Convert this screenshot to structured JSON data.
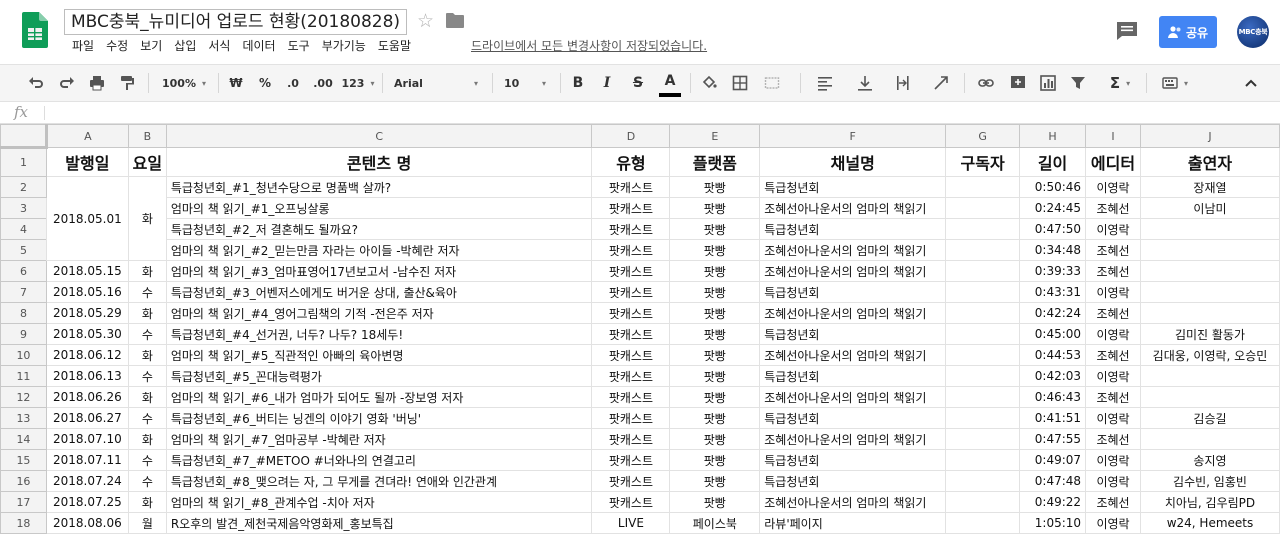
{
  "doc": {
    "title": "MBC충북_뉴미디어 업로드 현황(20180828)",
    "saved_notice": "드라이브에서 모든 변경사항이 저장되었습니다.",
    "share_label": "공유",
    "avatar_text": "MBC충북"
  },
  "menu": [
    "파일",
    "수정",
    "보기",
    "삽입",
    "서식",
    "데이터",
    "도구",
    "부가기능",
    "도움말"
  ],
  "toolbar": {
    "zoom": "100%",
    "currency": "₩",
    "percent": "%",
    "decimal_less": ".0",
    "decimal_more": ".00",
    "number_format": "123",
    "font": "Arial",
    "font_size": "10",
    "bold": "B",
    "italic": "I",
    "strike": "S",
    "text_color": "A",
    "sigma": "Σ"
  },
  "formula_bar": {
    "fx": "fx",
    "value": ""
  },
  "columns": [
    "A",
    "B",
    "C",
    "D",
    "E",
    "F",
    "G",
    "H",
    "I",
    "J"
  ],
  "header_row": [
    "발행일",
    "요일",
    "콘텐츠 명",
    "유형",
    "플랫폼",
    "채널명",
    "구독자",
    "길이",
    "에디터",
    "출연자"
  ],
  "merged_first": {
    "date": "2018.05.01",
    "day": "화"
  },
  "rows": [
    {
      "n": "2",
      "date": "",
      "day": "",
      "title": "특급청년회_#1_청년수당으로 명품백 살까?",
      "type": "팟캐스트",
      "platform": "팟빵",
      "channel": "특급청년회",
      "subs": "",
      "length": "0:50:46",
      "editor": "이영락",
      "cast": "장재열"
    },
    {
      "n": "3",
      "date": "",
      "day": "",
      "title": "엄마의 책 읽기_#1_오프닝살롱",
      "type": "팟캐스트",
      "platform": "팟빵",
      "channel": "조혜선아나운서의 엄마의 책읽기",
      "subs": "",
      "length": "0:24:45",
      "editor": "조혜선",
      "cast": "이남미"
    },
    {
      "n": "4",
      "date": "",
      "day": "",
      "title": "특급청년회_#2_저 결혼해도 될까요?",
      "type": "팟캐스트",
      "platform": "팟빵",
      "channel": "특급청년회",
      "subs": "",
      "length": "0:47:50",
      "editor": "이영락",
      "cast": ""
    },
    {
      "n": "5",
      "date": "",
      "day": "",
      "title": "엄마의 책 읽기_#2_믿는만큼 자라는 아이들 -박혜란 저자",
      "type": "팟캐스트",
      "platform": "팟빵",
      "channel": "조혜선아나운서의 엄마의 책읽기",
      "subs": "",
      "length": "0:34:48",
      "editor": "조혜선",
      "cast": ""
    },
    {
      "n": "6",
      "date": "2018.05.15",
      "day": "화",
      "title": "엄마의 책 읽기_#3_엄마표영어17년보고서 -남수진 저자",
      "type": "팟캐스트",
      "platform": "팟빵",
      "channel": "조혜선아나운서의 엄마의 책읽기",
      "subs": "",
      "length": "0:39:33",
      "editor": "조혜선",
      "cast": ""
    },
    {
      "n": "7",
      "date": "2018.05.16",
      "day": "수",
      "title": "특급청년회_#3_어벤저스에게도 버거운 상대, 출산&육아",
      "type": "팟캐스트",
      "platform": "팟빵",
      "channel": "특급청년회",
      "subs": "",
      "length": "0:43:31",
      "editor": "이영락",
      "cast": ""
    },
    {
      "n": "8",
      "date": "2018.05.29",
      "day": "화",
      "title": "엄마의 책 읽기_#4_영어그림책의 기적 -전은주 저자",
      "type": "팟캐스트",
      "platform": "팟빵",
      "channel": "조혜선아나운서의 엄마의 책읽기",
      "subs": "",
      "length": "0:42:24",
      "editor": "조혜선",
      "cast": ""
    },
    {
      "n": "9",
      "date": "2018.05.30",
      "day": "수",
      "title": "특급청년회_#4_선거권, 너두? 나두? 18세두!",
      "type": "팟캐스트",
      "platform": "팟빵",
      "channel": "특급청년회",
      "subs": "",
      "length": "0:45:00",
      "editor": "이영락",
      "cast": "김미진 활동가"
    },
    {
      "n": "10",
      "date": "2018.06.12",
      "day": "화",
      "title": "엄마의 책 읽기_#5_직관적인 아빠의 육아변명",
      "type": "팟캐스트",
      "platform": "팟빵",
      "channel": "조혜선아나운서의 엄마의 책읽기",
      "subs": "",
      "length": "0:44:53",
      "editor": "조혜선",
      "cast": "김대웅, 이영락, 오승민"
    },
    {
      "n": "11",
      "date": "2018.06.13",
      "day": "수",
      "title": "특급청년회_#5_꼰대능력평가",
      "type": "팟캐스트",
      "platform": "팟빵",
      "channel": "특급청년회",
      "subs": "",
      "length": "0:42:03",
      "editor": "이영락",
      "cast": ""
    },
    {
      "n": "12",
      "date": "2018.06.26",
      "day": "화",
      "title": "엄마의 책 읽기_#6_내가 엄마가 되어도 될까 -장보영 저자",
      "type": "팟캐스트",
      "platform": "팟빵",
      "channel": "조혜선아나운서의 엄마의 책읽기",
      "subs": "",
      "length": "0:46:43",
      "editor": "조혜선",
      "cast": ""
    },
    {
      "n": "13",
      "date": "2018.06.27",
      "day": "수",
      "title": "특급청년회_#6_버티는 닝겐의 이야기 영화 '버닝'",
      "type": "팟캐스트",
      "platform": "팟빵",
      "channel": "특급청년회",
      "subs": "",
      "length": "0:41:51",
      "editor": "이영락",
      "cast": "김승길"
    },
    {
      "n": "14",
      "date": "2018.07.10",
      "day": "화",
      "title": "엄마의 책 읽기_#7_엄마공부 -박혜란 저자",
      "type": "팟캐스트",
      "platform": "팟빵",
      "channel": "조혜선아나운서의 엄마의 책읽기",
      "subs": "",
      "length": "0:47:55",
      "editor": "조혜선",
      "cast": ""
    },
    {
      "n": "15",
      "date": "2018.07.11",
      "day": "수",
      "title": "특급청년회_#7_#METOO #너와나의 연결고리",
      "type": "팟캐스트",
      "platform": "팟빵",
      "channel": "특급청년회",
      "subs": "",
      "length": "0:49:07",
      "editor": "이영락",
      "cast": "송지영"
    },
    {
      "n": "16",
      "date": "2018.07.24",
      "day": "수",
      "title": "특급청년회_#8_맺으려는 자, 그 무게를 견뎌라! 연애와 인간관계",
      "type": "팟캐스트",
      "platform": "팟빵",
      "channel": "특급청년회",
      "subs": "",
      "length": "0:47:48",
      "editor": "이영락",
      "cast": "김수빈, 임홍빈"
    },
    {
      "n": "17",
      "date": "2018.07.25",
      "day": "화",
      "title": "엄마의 책 읽기_#8_관계수업 -치아 저자",
      "type": "팟캐스트",
      "platform": "팟빵",
      "channel": "조혜선아나운서의 엄마의 책읽기",
      "subs": "",
      "length": "0:49:22",
      "editor": "조혜선",
      "cast": "치아님, 김우림PD"
    },
    {
      "n": "18",
      "date": "2018.08.06",
      "day": "월",
      "title": "R오후의 발견_제천국제음악영화제_홍보특집",
      "type": "LIVE",
      "platform": "페이스북",
      "channel": "라뷰'페이지",
      "subs": "",
      "length": "1:05:10",
      "editor": "이영락",
      "cast": "w24, Hemeets"
    }
  ]
}
